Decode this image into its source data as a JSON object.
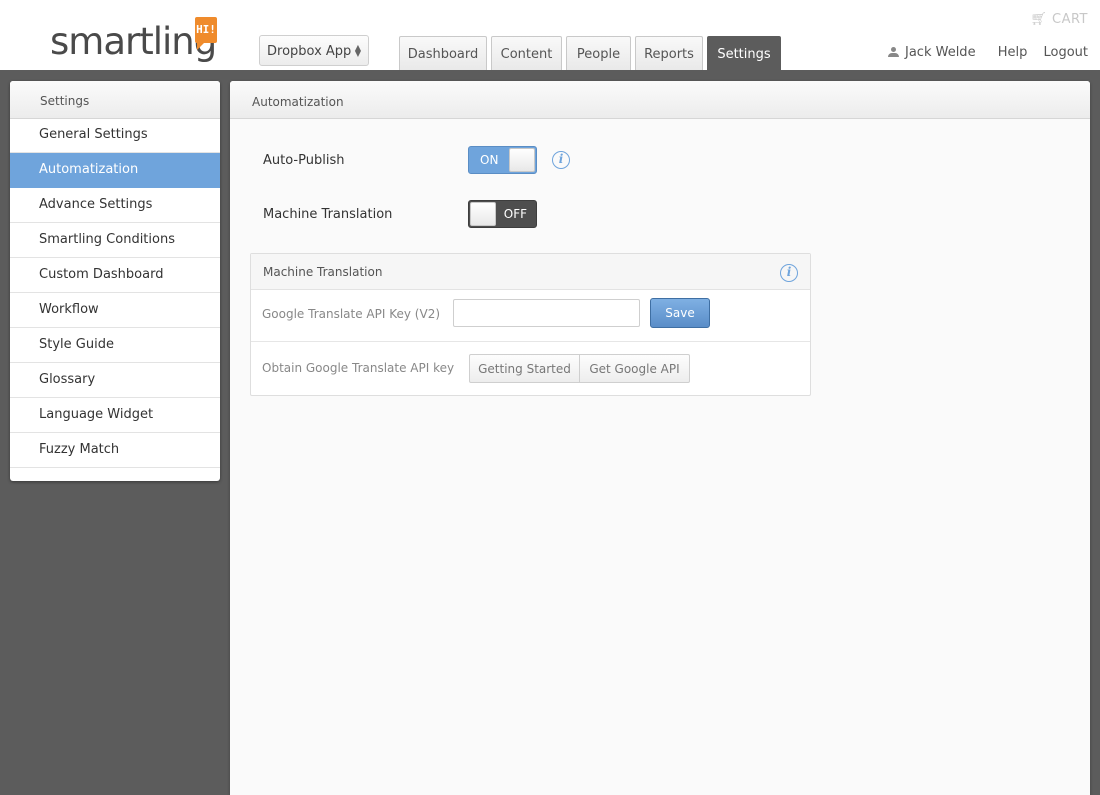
{
  "header": {
    "logo_text": "smartling",
    "logo_badge": "HI!",
    "project": "Dropbox App",
    "tabs": [
      {
        "label": "Dashboard"
      },
      {
        "label": "Content"
      },
      {
        "label": "People"
      },
      {
        "label": "Reports"
      },
      {
        "label": "Settings",
        "active": true
      }
    ],
    "cart_label": "CART",
    "user_name": "Jack Welde",
    "help_label": "Help",
    "logout_label": "Logout"
  },
  "sidebar": {
    "title": "Settings",
    "items": [
      {
        "label": "General Settings"
      },
      {
        "label": "Automatization",
        "active": true
      },
      {
        "label": "Advance Settings"
      },
      {
        "label": "Smartling Conditions"
      },
      {
        "label": "Custom Dashboard"
      },
      {
        "label": "Workflow"
      },
      {
        "label": "Style Guide"
      },
      {
        "label": "Glossary"
      },
      {
        "label": "Language Widget"
      },
      {
        "label": "Fuzzy Match"
      }
    ]
  },
  "main": {
    "title": "Automatization",
    "auto_publish": {
      "label": "Auto-Publish",
      "state": "ON"
    },
    "machine_translation": {
      "label": "Machine Translation",
      "state": "OFF"
    },
    "mt_box": {
      "title": "Machine Translation",
      "api_key_label": "Google Translate API Key (V2)",
      "api_key_value": "",
      "save_label": "Save",
      "obtain_label": "Obtain Google Translate API key",
      "getting_started_label": "Getting Started",
      "get_google_api_label": "Get Google API"
    }
  },
  "colors": {
    "accent": "#6fa4dc",
    "brand_orange": "#ef8b2c",
    "dark_bg": "#5c5c5c"
  }
}
